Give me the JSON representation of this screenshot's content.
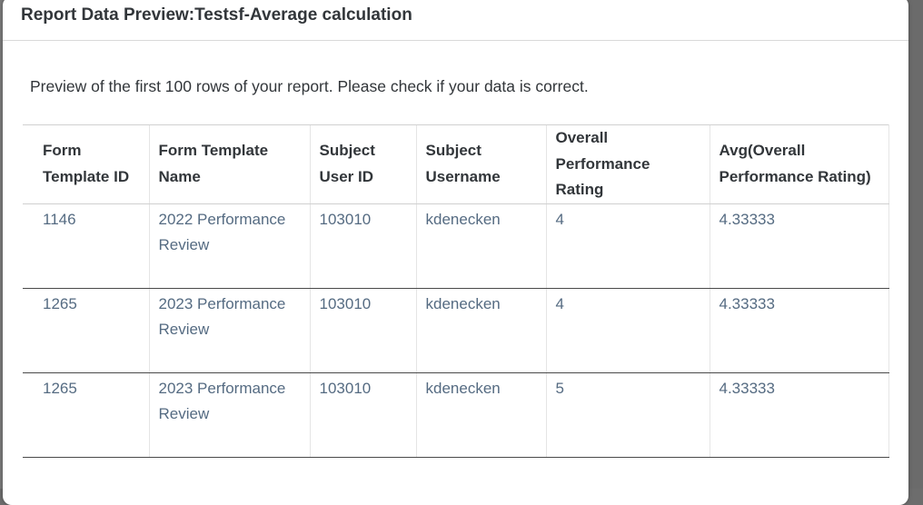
{
  "dialog": {
    "title": "Report Data Preview:Testsf-Average calculation",
    "intro": "Preview of the first 100 rows of your report. Please check if your data is correct."
  },
  "table": {
    "columns": [
      "Form Template ID",
      "Form Template Name",
      "Subject User ID",
      "Subject Username",
      "Overall Performance Rating",
      "Avg(Overall Performance Rating)"
    ],
    "rows": [
      [
        "1146",
        "2022 Performance Review",
        "103010",
        "kdenecken",
        "4",
        "4.33333"
      ],
      [
        "1265",
        "2023 Performance Review",
        "103010",
        "kdenecken",
        "4",
        "4.33333"
      ],
      [
        "1265",
        "2023 Performance Review",
        "103010",
        "kdenecken",
        "5",
        "4.33333"
      ]
    ]
  }
}
